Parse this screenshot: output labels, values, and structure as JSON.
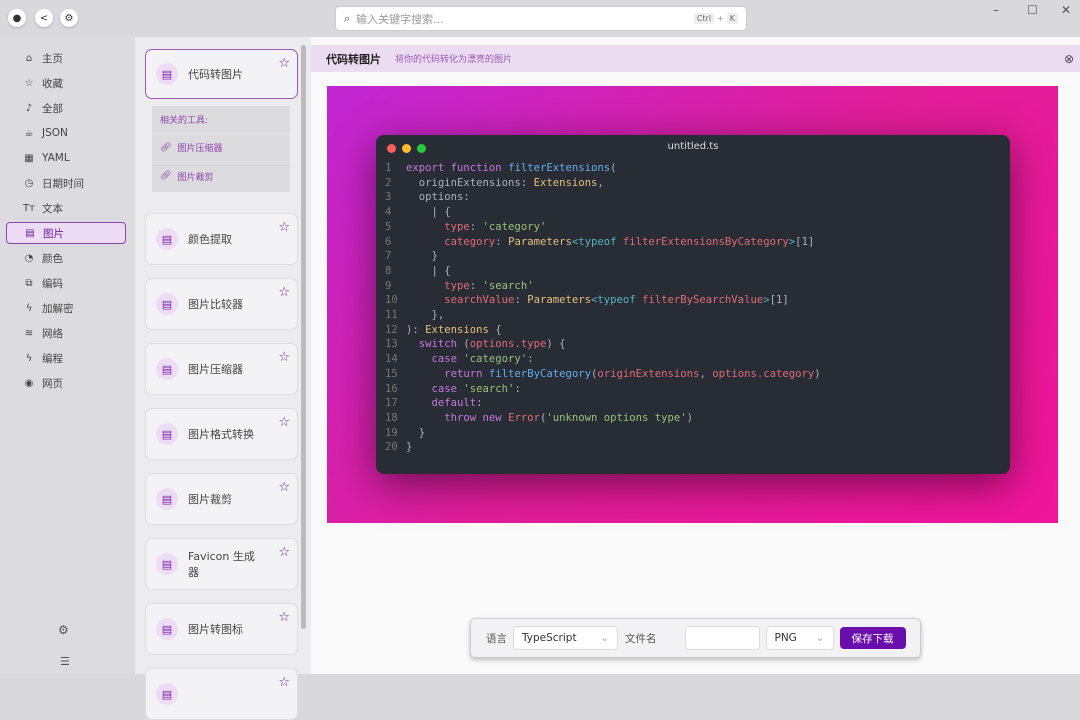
{
  "topbar": {
    "search_placeholder": "输入关键字搜索...",
    "shortcut_ctrl": "Ctrl",
    "shortcut_plus": "+",
    "shortcut_k": "K"
  },
  "sidebar": {
    "items": [
      {
        "label": "主页",
        "icon": "home-icon",
        "glyph": "⌂"
      },
      {
        "label": "收藏",
        "icon": "star-icon",
        "glyph": "☆"
      },
      {
        "label": "全部",
        "icon": "bell-icon",
        "glyph": "♪"
      },
      {
        "label": "JSON",
        "icon": "cup-icon",
        "glyph": "☕"
      },
      {
        "label": "YAML",
        "icon": "grid-icon",
        "glyph": "▦"
      },
      {
        "label": "日期时间",
        "icon": "clock-icon",
        "glyph": "◷"
      },
      {
        "label": "文本",
        "icon": "text-icon",
        "glyph": "Tт"
      },
      {
        "label": "图片",
        "icon": "image-file-icon",
        "glyph": "▤"
      },
      {
        "label": "颜色",
        "icon": "palette-icon",
        "glyph": "◔"
      },
      {
        "label": "编码",
        "icon": "encode-icon",
        "glyph": "⧉"
      },
      {
        "label": "加解密",
        "icon": "bolt-icon",
        "glyph": "ϟ"
      },
      {
        "label": "网络",
        "icon": "wifi-icon",
        "glyph": "≋"
      },
      {
        "label": "编程",
        "icon": "code-bolt-icon",
        "glyph": "ϟ"
      },
      {
        "label": "网页",
        "icon": "globe-icon",
        "glyph": "◉"
      }
    ],
    "active": 7
  },
  "tools": {
    "cards": [
      "代码转图片",
      "颜色提取",
      "图片比较器",
      "图片压缩器",
      "图片格式转换",
      "图片裁剪",
      "Favicon 生成器",
      "图片转图标",
      ""
    ],
    "related_title": "相关的工具:",
    "related": [
      "图片压缩器",
      "图片裁剪"
    ]
  },
  "main": {
    "title": "代码转图片",
    "subtitle": "将你的代码转化为漂亮的图片"
  },
  "editor": {
    "filename": "untitled.ts",
    "colors": {
      "red": "#ff5f56",
      "yellow": "#ffbd2e",
      "green": "#27c93f"
    },
    "lines": [
      [
        [
          "k",
          "export "
        ],
        [
          "k",
          "function "
        ],
        [
          "f",
          "filterExtensions"
        ],
        [
          "d",
          "("
        ]
      ],
      [
        [
          "d",
          "  originExtensions: "
        ],
        [
          "t",
          "Extensions"
        ],
        [
          "d",
          ","
        ]
      ],
      [
        [
          "d",
          "  options:"
        ]
      ],
      [
        [
          "d",
          "    | {"
        ]
      ],
      [
        [
          "p",
          "      type"
        ],
        [
          "d",
          ": "
        ],
        [
          "s",
          "'category'"
        ]
      ],
      [
        [
          "p",
          "      category"
        ],
        [
          "d",
          ": "
        ],
        [
          "t",
          "Parameters"
        ],
        [
          "c",
          "<typeof "
        ],
        [
          "p",
          "filterExtensionsByCategory"
        ],
        [
          "c",
          ">"
        ],
        [
          "d",
          "[1]"
        ]
      ],
      [
        [
          "d",
          "    }"
        ]
      ],
      [
        [
          "d",
          "    | {"
        ]
      ],
      [
        [
          "p",
          "      type"
        ],
        [
          "d",
          ": "
        ],
        [
          "s",
          "'search'"
        ]
      ],
      [
        [
          "p",
          "      searchValue"
        ],
        [
          "d",
          ": "
        ],
        [
          "t",
          "Parameters"
        ],
        [
          "c",
          "<typeof "
        ],
        [
          "p",
          "filterBySearchValue"
        ],
        [
          "c",
          ">"
        ],
        [
          "d",
          "[1]"
        ]
      ],
      [
        [
          "d",
          "    },"
        ]
      ],
      [
        [
          "d",
          "): "
        ],
        [
          "t",
          "Extensions"
        ],
        [
          "d",
          " {"
        ]
      ],
      [
        [
          "k",
          "  switch "
        ],
        [
          "d",
          "("
        ],
        [
          "p",
          "options.type"
        ],
        [
          "d",
          ") {"
        ]
      ],
      [
        [
          "k",
          "    case "
        ],
        [
          "s",
          "'category'"
        ],
        [
          "d",
          ":"
        ]
      ],
      [
        [
          "k",
          "      return "
        ],
        [
          "f",
          "filterByCategory"
        ],
        [
          "d",
          "("
        ],
        [
          "p",
          "originExtensions"
        ],
        [
          "d",
          ", "
        ],
        [
          "p",
          "options.category"
        ],
        [
          "d",
          ")"
        ]
      ],
      [
        [
          "k",
          "    case "
        ],
        [
          "s",
          "'search'"
        ],
        [
          "d",
          ":"
        ]
      ],
      [
        [
          "k",
          "    default"
        ],
        [
          "d",
          ":"
        ]
      ],
      [
        [
          "k",
          "      throw new "
        ],
        [
          "p",
          "Error"
        ],
        [
          "d",
          "("
        ],
        [
          "s",
          "'unknown options type'"
        ],
        [
          "d",
          ")"
        ]
      ],
      [
        [
          "d",
          "  }"
        ]
      ],
      [
        [
          "d",
          "}"
        ]
      ]
    ]
  },
  "bottom": {
    "language_label": "语言",
    "language": "TypeScript",
    "filename_label": "文件名",
    "filename_value": "",
    "format": "PNG",
    "save": "保存下载"
  }
}
